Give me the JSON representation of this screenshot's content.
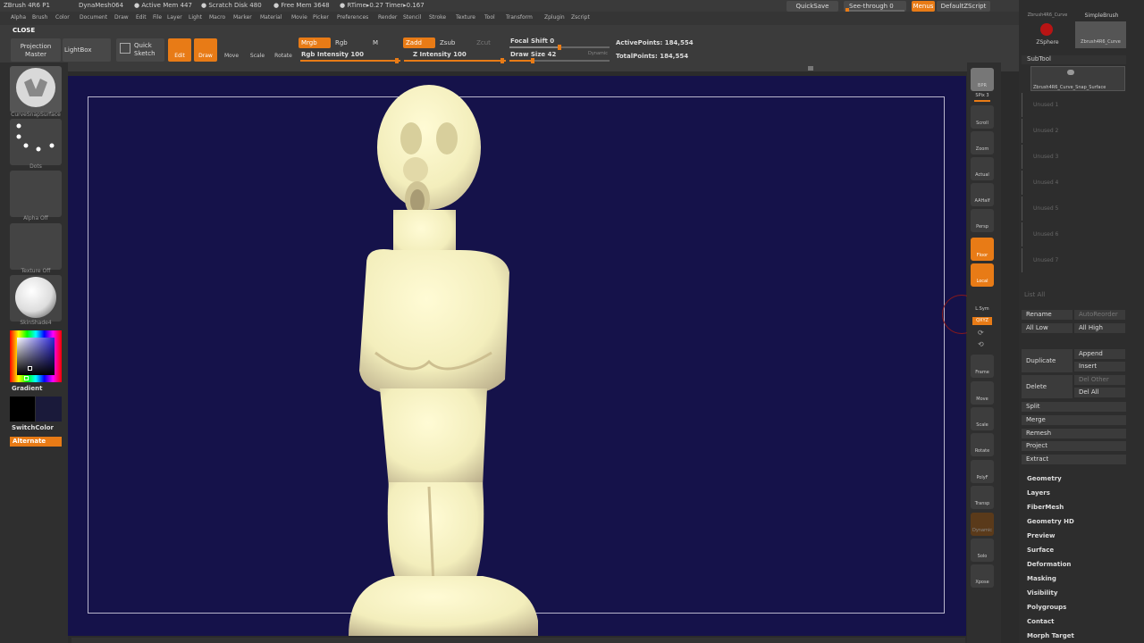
{
  "titlebar": {
    "app": "ZBrush 4R6 P1",
    "doc": "DynaMesh064",
    "active_mem": "● Active Mem 447",
    "scratch": "● Scratch Disk 480",
    "free_mem": "● Free Mem 3648",
    "rtime": "● RTime▸0.27 Timer▸0.167",
    "quicksave": "QuickSave",
    "see_through": "See-through  0",
    "menus": "Menus",
    "default_script": "DefaultZScript"
  },
  "menubar": [
    "Alpha",
    "Brush",
    "Color",
    "Document",
    "Draw",
    "Edit",
    "File",
    "Layer",
    "Light",
    "Macro",
    "Marker",
    "Material",
    "Movie",
    "Picker",
    "Preferences",
    "Render",
    "Stencil",
    "Stroke",
    "Texture",
    "Tool",
    "Transform",
    "Zplugin",
    "Zscript"
  ],
  "toolbar": {
    "close": "CLOSE",
    "projection_master_1": "Projection",
    "projection_master_2": "Master",
    "lightbox": "LightBox",
    "quick_sketch_1": "Quick",
    "quick_sketch_2": "Sketch",
    "edit": "Edit",
    "draw": "Draw",
    "move": "Move",
    "scale": "Scale",
    "rotate": "Rotate",
    "mrgb": "Mrgb",
    "rgb": "Rgb",
    "m": "M",
    "rgb_intensity": "Rgb Intensity 100",
    "zadd": "Zadd",
    "zsub": "Zsub",
    "zcut": "Zcut",
    "z_intensity": "Z Intensity 100",
    "focal_shift": "Focal Shift 0",
    "draw_size": "Draw Size 42",
    "dynamic": "Dynamic",
    "active_points": "ActivePoints: 184,554",
    "total_points": "TotalPoints: 184,554",
    "rgb_intensity_value": 100,
    "z_intensity_value": 100,
    "draw_size_value": 42,
    "focal_shift_value": 0
  },
  "leftshelf": {
    "brush_caption": "CurveSnapSurface",
    "stroke_caption": "Dots",
    "alpha_caption": "Alpha Off",
    "texture_caption": "Texture Off",
    "material_caption": "SkinShade4",
    "gradient": "Gradient",
    "switchcolor": "SwitchColor",
    "alternate": "Alternate"
  },
  "rightshelf": [
    {
      "name": "bpr",
      "label": "BPR"
    },
    {
      "name": "spix",
      "label": "SPix 3"
    },
    {
      "name": "scroll",
      "label": "Scroll"
    },
    {
      "name": "zoom",
      "label": "Zoom"
    },
    {
      "name": "actual",
      "label": "Actual"
    },
    {
      "name": "aahalf",
      "label": "AAHalf"
    },
    {
      "name": "persp",
      "label": "Persp"
    },
    {
      "name": "floor",
      "label": "Floor"
    },
    {
      "name": "local",
      "label": "Local"
    },
    {
      "name": "lsym",
      "label": "L.Sym"
    },
    {
      "name": "xyz",
      "label": "QXYZ"
    },
    {
      "name": "frame",
      "label": "Frame"
    },
    {
      "name": "move",
      "label": "Move"
    },
    {
      "name": "scale",
      "label": "Scale"
    },
    {
      "name": "rotate",
      "label": "Rotate"
    },
    {
      "name": "polyf",
      "label": "PolyF"
    },
    {
      "name": "transp",
      "label": "Transp"
    },
    {
      "name": "dynamic",
      "label": "Dynamic"
    },
    {
      "name": "solo",
      "label": "Solo"
    },
    {
      "name": "xpose",
      "label": "Xpose"
    }
  ],
  "rpanel": {
    "tool_thumb_1": "Zbrush4R6_Curve",
    "tool_thumb_2": "SimpleBrush",
    "tool_thumb_3": "ZSphere",
    "tool_thumb_4": "Zbrush4R6_Curve",
    "subtool_title": "SubTool",
    "subtool_active": "Zbrush4R6_Curve_Snap_Surface",
    "unused": [
      "Unused 1",
      "Unused 2",
      "Unused 3",
      "Unused 4",
      "Unused 5",
      "Unused 6",
      "Unused 7"
    ],
    "list_all": "List All",
    "rename": "Rename",
    "autoreorder": "AutoReorder",
    "all_low": "All Low",
    "all_high": "All High",
    "duplicate": "Duplicate",
    "append": "Append",
    "insert": "Insert",
    "delete": "Delete",
    "del_other": "Del Other",
    "del_all": "Del All",
    "split": "Split",
    "merge": "Merge",
    "remesh": "Remesh",
    "project": "Project",
    "extract": "Extract",
    "menus": [
      "Geometry",
      "Layers",
      "FiberMesh",
      "Geometry HD",
      "Preview",
      "Surface",
      "Deformation",
      "Masking",
      "Visibility",
      "Polygroups",
      "Contact",
      "Morph Target"
    ]
  },
  "colors": {
    "accent": "#e87b16",
    "canvas": "#15124a",
    "figure": "#f3eebc"
  }
}
